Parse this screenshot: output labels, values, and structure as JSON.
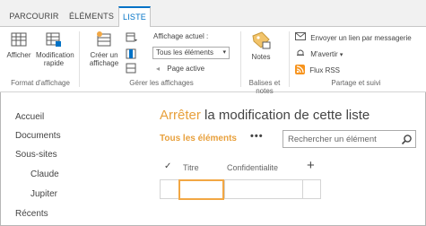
{
  "tabs": [
    "PARCOURIR",
    "ÉLÉMENTS",
    "LISTE"
  ],
  "ribbon": {
    "format_group": {
      "label": "Format d'affichage",
      "buttons": [
        "Afficher",
        "Modification rapide"
      ]
    },
    "views_group": {
      "label": "Gérer les affichages",
      "create_view": "Créer un affichage",
      "current_view_label": "Affichage actuel :",
      "current_view_value": "Tous les éléments",
      "page_label": "Page active"
    },
    "tags_group": {
      "label": "Balises et notes",
      "notes": "Notes"
    },
    "share_group": {
      "label": "Partage et suivi",
      "email_link": "Envoyer un lien par messagerie",
      "alert": "M'avertir",
      "rss": "Flux RSS"
    }
  },
  "nav": {
    "items": [
      {
        "label": "Accueil"
      },
      {
        "label": "Documents"
      },
      {
        "label": "Sous-sites"
      },
      {
        "label": "Claude"
      },
      {
        "label": "Jupiter"
      },
      {
        "label": "Récents"
      }
    ]
  },
  "main": {
    "title_accent": "Arrêter",
    "title_rest": " la modification de cette liste",
    "view_link": "Tous les éléments",
    "ellipsis": "•••",
    "search_placeholder": "Rechercher un élément",
    "columns": [
      "✓",
      "Titre",
      "Confidentialite",
      "+"
    ]
  },
  "colors": {
    "accent": "#e8a03c",
    "tab_active": "#0072c6",
    "rss": "#f7941e"
  }
}
